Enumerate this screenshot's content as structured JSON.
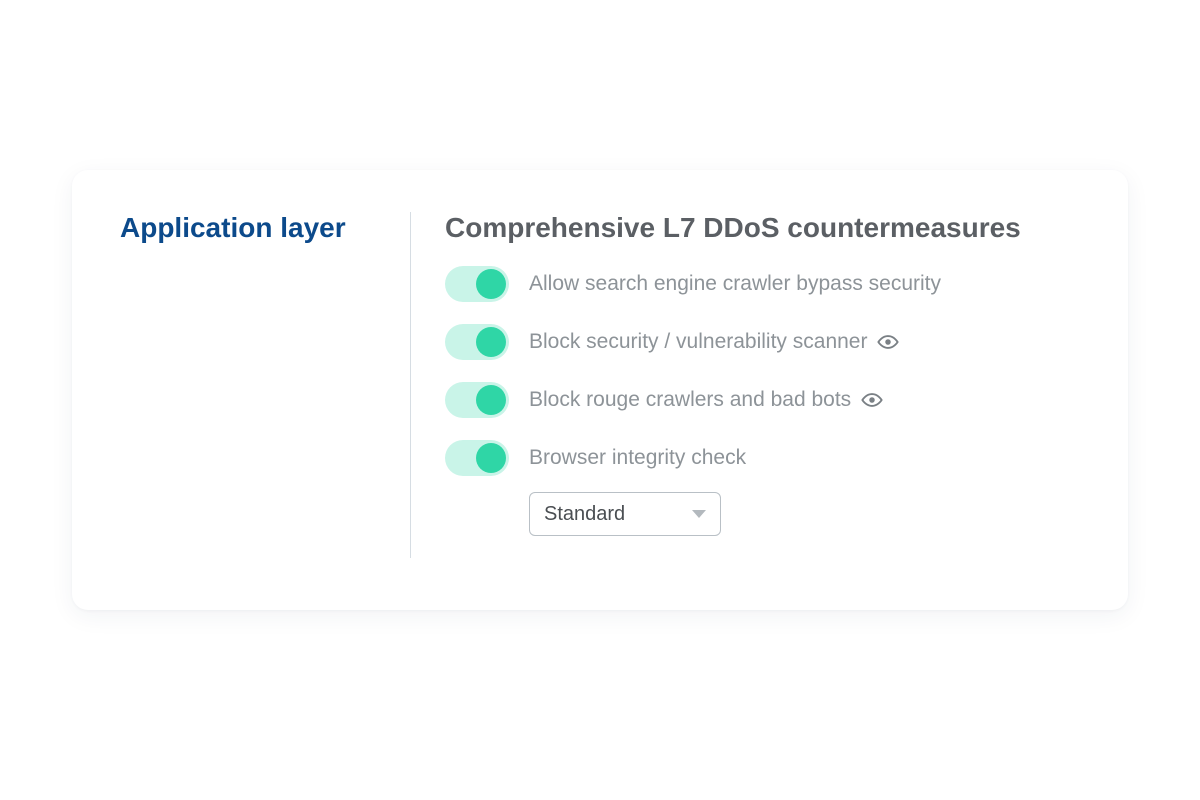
{
  "sidebar": {
    "title": "Application layer"
  },
  "content": {
    "title": "Comprehensive L7 DDoS countermeasures",
    "settings": [
      {
        "label": "Allow search engine crawler bypass security",
        "on": true,
        "has_eye": false
      },
      {
        "label": "Block security / vulnerability scanner",
        "on": true,
        "has_eye": true
      },
      {
        "label": "Block rouge crawlers and bad bots",
        "on": true,
        "has_eye": true
      },
      {
        "label": "Browser integrity check",
        "on": true,
        "has_eye": false
      }
    ],
    "integrity_select": {
      "value": "Standard"
    }
  }
}
